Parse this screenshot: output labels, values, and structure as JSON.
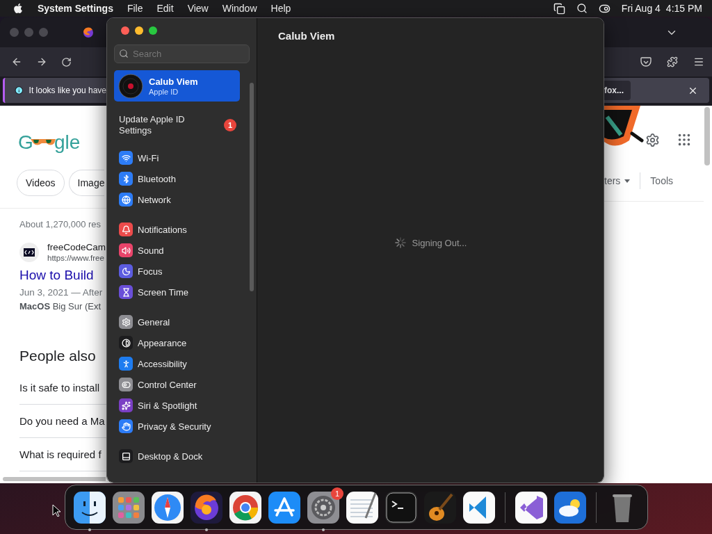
{
  "menu_bar": {
    "app": "System Settings",
    "menus": [
      "File",
      "Edit",
      "View",
      "Window",
      "Help"
    ],
    "date": "Fri Aug 4",
    "time": "4:15 PM"
  },
  "browser": {
    "notification": "It looks like you have",
    "notification_button": "fox...",
    "logo": {
      "start": "G",
      "end": "gle"
    },
    "filters_left": [
      "Videos",
      "Image"
    ],
    "filters_right": [
      "ters",
      "Tools"
    ],
    "results_count": "About 1,270,000 res",
    "result": {
      "site": "freeCodeCam",
      "url": "https://www.free",
      "title": "How to Build",
      "date": "Jun 3, 2021 — After",
      "snippet": "**MacOS** Big Sur (Ext"
    },
    "people_heading": "People also",
    "questions": [
      "Is it safe to install",
      "Do you need a Ma",
      "What is required f"
    ]
  },
  "settings": {
    "search": {
      "placeholder": "Search"
    },
    "account": {
      "name": "Calub Viem",
      "subtitle": "Apple ID",
      "selected": true
    },
    "update": {
      "label": "Update Apple ID Settings",
      "badge": "1"
    },
    "groups": [
      [
        {
          "label": "Wi-Fi",
          "color": "#2d7cf6"
        },
        {
          "label": "Bluetooth",
          "color": "#2d7cf6"
        },
        {
          "label": "Network",
          "color": "#2d7cf6"
        }
      ],
      [
        {
          "label": "Notifications",
          "color": "#ec4b4b"
        },
        {
          "label": "Sound",
          "color": "#e9446a"
        },
        {
          "label": "Focus",
          "color": "#5c5ce0"
        },
        {
          "label": "Screen Time",
          "color": "#6a4fd8"
        }
      ],
      [
        {
          "label": "General",
          "color": "#8e8e93"
        },
        {
          "label": "Appearance",
          "color": "#1c1c1e"
        },
        {
          "label": "Accessibility",
          "color": "#1e7cf0"
        },
        {
          "label": "Control Center",
          "color": "#8e8e93"
        },
        {
          "label": "Siri & Spotlight",
          "color": "#7a3fc4"
        },
        {
          "label": "Privacy & Security",
          "color": "#2d7cf6"
        }
      ],
      [
        {
          "label": "Desktop & Dock",
          "color": "#1c1c1e"
        }
      ]
    ],
    "title": "Calub Viem",
    "status": "Signing Out..."
  },
  "dock": {
    "sections": [
      [
        {
          "running": true
        },
        {
          "running": false
        },
        {
          "running": false
        },
        {
          "running": true
        },
        {
          "running": false
        },
        {
          "running": false
        },
        {
          "running": true,
          "badge": "1"
        },
        {
          "running": false
        },
        {
          "running": false
        },
        {
          "running": false
        },
        {
          "running": false
        }
      ],
      [
        {
          "running": false
        },
        {
          "running": false
        }
      ],
      [
        {
          "running": false
        }
      ]
    ]
  }
}
